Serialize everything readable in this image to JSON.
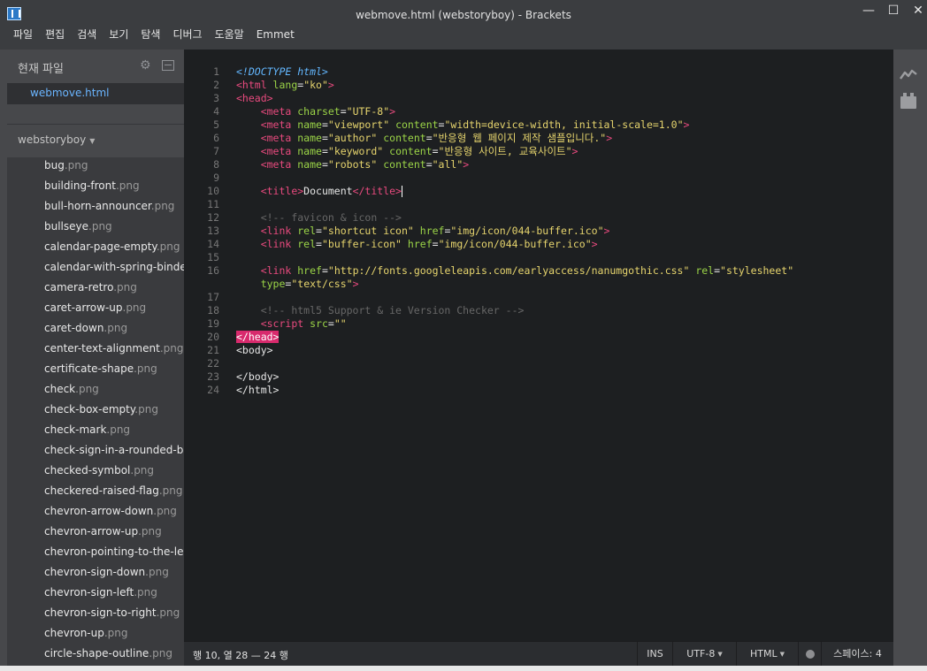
{
  "window": {
    "title": "webmove.html (webstoryboy) - Brackets",
    "minimize": "—",
    "maximize": "☐",
    "close": "✕"
  },
  "menu": [
    "파일",
    "편집",
    "검색",
    "보기",
    "탐색",
    "디버그",
    "도움말",
    "Emmet"
  ],
  "sidebar": {
    "working_files_header": "현재 파일",
    "working_file": "webmove.html",
    "project_name": "webstoryboy",
    "project_caret": "▼",
    "files": [
      {
        "name": "bug",
        "ext": ".png"
      },
      {
        "name": "building-front",
        "ext": ".png"
      },
      {
        "name": "bull-horn-announcer",
        "ext": ".png"
      },
      {
        "name": "bullseye",
        "ext": ".png"
      },
      {
        "name": "calendar-page-empty",
        "ext": ".png"
      },
      {
        "name": "calendar-with-spring-binde",
        "ext": ""
      },
      {
        "name": "camera-retro",
        "ext": ".png"
      },
      {
        "name": "caret-arrow-up",
        "ext": ".png"
      },
      {
        "name": "caret-down",
        "ext": ".png"
      },
      {
        "name": "center-text-alignment",
        "ext": ".png"
      },
      {
        "name": "certificate-shape",
        "ext": ".png"
      },
      {
        "name": "check",
        "ext": ".png"
      },
      {
        "name": "check-box-empty",
        "ext": ".png"
      },
      {
        "name": "check-mark",
        "ext": ".png"
      },
      {
        "name": "check-sign-in-a-rounded-bl",
        "ext": ""
      },
      {
        "name": "checked-symbol",
        "ext": ".png"
      },
      {
        "name": "checkered-raised-flag",
        "ext": ".png"
      },
      {
        "name": "chevron-arrow-down",
        "ext": ".png"
      },
      {
        "name": "chevron-arrow-up",
        "ext": ".png"
      },
      {
        "name": "chevron-pointing-to-the-le",
        "ext": ""
      },
      {
        "name": "chevron-sign-down",
        "ext": ".png"
      },
      {
        "name": "chevron-sign-left",
        "ext": ".png"
      },
      {
        "name": "chevron-sign-to-right",
        "ext": ".png"
      },
      {
        "name": "chevron-up",
        "ext": ".png"
      },
      {
        "name": "circle-shape-outline",
        "ext": ".png"
      }
    ]
  },
  "editor": {
    "line_numbers": [
      "1",
      "2",
      "3",
      "4",
      "5",
      "6",
      "7",
      "8",
      "9",
      "10",
      "11",
      "12",
      "13",
      "14",
      "15",
      "16",
      "",
      "17",
      "18",
      "19",
      "20",
      "21",
      "22",
      "23",
      "24"
    ],
    "lines": [
      [
        {
          "c": "doctype",
          "t": "<!DOCTYPE html>"
        }
      ],
      [
        {
          "c": "tag",
          "t": "<html "
        },
        {
          "c": "attr",
          "t": "lang"
        },
        {
          "c": "txt",
          "t": "="
        },
        {
          "c": "val",
          "t": "\"ko\""
        },
        {
          "c": "tag",
          "t": ">"
        }
      ],
      [
        {
          "c": "tag",
          "t": "<head>"
        }
      ],
      [
        {
          "c": "txt",
          "t": "    "
        },
        {
          "c": "tag",
          "t": "<meta "
        },
        {
          "c": "attr",
          "t": "charset"
        },
        {
          "c": "txt",
          "t": "="
        },
        {
          "c": "val",
          "t": "\"UTF-8\""
        },
        {
          "c": "tag",
          "t": ">"
        }
      ],
      [
        {
          "c": "txt",
          "t": "    "
        },
        {
          "c": "tag",
          "t": "<meta "
        },
        {
          "c": "attr",
          "t": "name"
        },
        {
          "c": "txt",
          "t": "="
        },
        {
          "c": "val",
          "t": "\"viewport\""
        },
        {
          "c": "txt",
          "t": " "
        },
        {
          "c": "attr",
          "t": "content"
        },
        {
          "c": "txt",
          "t": "="
        },
        {
          "c": "val",
          "t": "\"width=device-width, initial-scale=1.0\""
        },
        {
          "c": "tag",
          "t": ">"
        }
      ],
      [
        {
          "c": "txt",
          "t": "    "
        },
        {
          "c": "tag",
          "t": "<meta "
        },
        {
          "c": "attr",
          "t": "name"
        },
        {
          "c": "txt",
          "t": "="
        },
        {
          "c": "val",
          "t": "\"author\""
        },
        {
          "c": "txt",
          "t": " "
        },
        {
          "c": "attr",
          "t": "content"
        },
        {
          "c": "txt",
          "t": "="
        },
        {
          "c": "val",
          "t": "\"반응형 웹 페이지 제작 샘플입니다.\""
        },
        {
          "c": "tag",
          "t": ">"
        }
      ],
      [
        {
          "c": "txt",
          "t": "    "
        },
        {
          "c": "tag",
          "t": "<meta "
        },
        {
          "c": "attr",
          "t": "name"
        },
        {
          "c": "txt",
          "t": "="
        },
        {
          "c": "val",
          "t": "\"keyword\""
        },
        {
          "c": "txt",
          "t": " "
        },
        {
          "c": "attr",
          "t": "content"
        },
        {
          "c": "txt",
          "t": "="
        },
        {
          "c": "val",
          "t": "\"반응형 사이트, 교육사이트\""
        },
        {
          "c": "tag",
          "t": ">"
        }
      ],
      [
        {
          "c": "txt",
          "t": "    "
        },
        {
          "c": "tag",
          "t": "<meta "
        },
        {
          "c": "attr",
          "t": "name"
        },
        {
          "c": "txt",
          "t": "="
        },
        {
          "c": "val",
          "t": "\"robots\""
        },
        {
          "c": "txt",
          "t": " "
        },
        {
          "c": "attr",
          "t": "content"
        },
        {
          "c": "txt",
          "t": "="
        },
        {
          "c": "val",
          "t": "\"all\""
        },
        {
          "c": "tag",
          "t": ">"
        }
      ],
      [],
      [
        {
          "c": "txt",
          "t": "    "
        },
        {
          "c": "tag",
          "t": "<title>"
        },
        {
          "c": "txt",
          "t": "Document"
        },
        {
          "c": "tag",
          "t": "</title>"
        },
        {
          "c": "cursor",
          "t": ""
        }
      ],
      [],
      [
        {
          "c": "txt",
          "t": "    "
        },
        {
          "c": "comment",
          "t": "<!-- favicon & icon -->"
        }
      ],
      [
        {
          "c": "txt",
          "t": "    "
        },
        {
          "c": "tag",
          "t": "<link "
        },
        {
          "c": "attr",
          "t": "rel"
        },
        {
          "c": "txt",
          "t": "="
        },
        {
          "c": "val",
          "t": "\"shortcut icon\""
        },
        {
          "c": "txt",
          "t": " "
        },
        {
          "c": "attr",
          "t": "href"
        },
        {
          "c": "txt",
          "t": "="
        },
        {
          "c": "val",
          "t": "\"img/icon/044-buffer.ico\""
        },
        {
          "c": "tag",
          "t": ">"
        }
      ],
      [
        {
          "c": "txt",
          "t": "    "
        },
        {
          "c": "tag",
          "t": "<link "
        },
        {
          "c": "attr",
          "t": "rel"
        },
        {
          "c": "txt",
          "t": "="
        },
        {
          "c": "val",
          "t": "\"buffer-icon\""
        },
        {
          "c": "txt",
          "t": " "
        },
        {
          "c": "attr",
          "t": "href"
        },
        {
          "c": "txt",
          "t": "="
        },
        {
          "c": "val",
          "t": "\"img/icon/044-buffer.ico\""
        },
        {
          "c": "tag",
          "t": ">"
        }
      ],
      [],
      [
        {
          "c": "txt",
          "t": "    "
        },
        {
          "c": "tag",
          "t": "<link "
        },
        {
          "c": "attr",
          "t": "href"
        },
        {
          "c": "txt",
          "t": "="
        },
        {
          "c": "val",
          "t": "\"http://fonts.googleleapis.com/earlyaccess/nanumgothic.css\""
        },
        {
          "c": "txt",
          "t": " "
        },
        {
          "c": "attr",
          "t": "rel"
        },
        {
          "c": "txt",
          "t": "="
        },
        {
          "c": "val",
          "t": "\"stylesheet\""
        }
      ],
      [
        {
          "c": "txt",
          "t": "    "
        },
        {
          "c": "attr",
          "t": "type"
        },
        {
          "c": "txt",
          "t": "="
        },
        {
          "c": "val",
          "t": "\"text/css\""
        },
        {
          "c": "tag",
          "t": ">"
        }
      ],
      [],
      [
        {
          "c": "txt",
          "t": "    "
        },
        {
          "c": "comment",
          "t": "<!-- html5 Support & ie Version Checker -->"
        }
      ],
      [
        {
          "c": "txt",
          "t": "    "
        },
        {
          "c": "tag",
          "t": "<script "
        },
        {
          "c": "attr",
          "t": "src"
        },
        {
          "c": "txt",
          "t": "="
        },
        {
          "c": "val",
          "t": "\"\""
        }
      ],
      [
        {
          "c": "hl",
          "t": "</head>"
        }
      ],
      [
        {
          "c": "txt",
          "t": "<body>"
        }
      ],
      [],
      [
        {
          "c": "txt",
          "t": "</body>"
        }
      ],
      [
        {
          "c": "txt",
          "t": "</html>"
        }
      ]
    ]
  },
  "statusbar": {
    "cursor_position": "행 10, 열 28 — 24 행",
    "mode": "INS",
    "encoding": "UTF-8",
    "language": "HTML",
    "indent": "스페이스: 4",
    "dropdown_caret": "▼"
  },
  "toolbar": {
    "live_preview_icon": "live-preview-icon",
    "extension_manager_icon": "extension-manager-icon"
  },
  "colors": {
    "tag": "#e84a7e",
    "attribute": "#9bd447",
    "value": "#e6d46d",
    "comment": "#676767",
    "doctype": "#63b7ff",
    "highlight": "#d82a6d",
    "active_file": "#6ab5ff"
  }
}
